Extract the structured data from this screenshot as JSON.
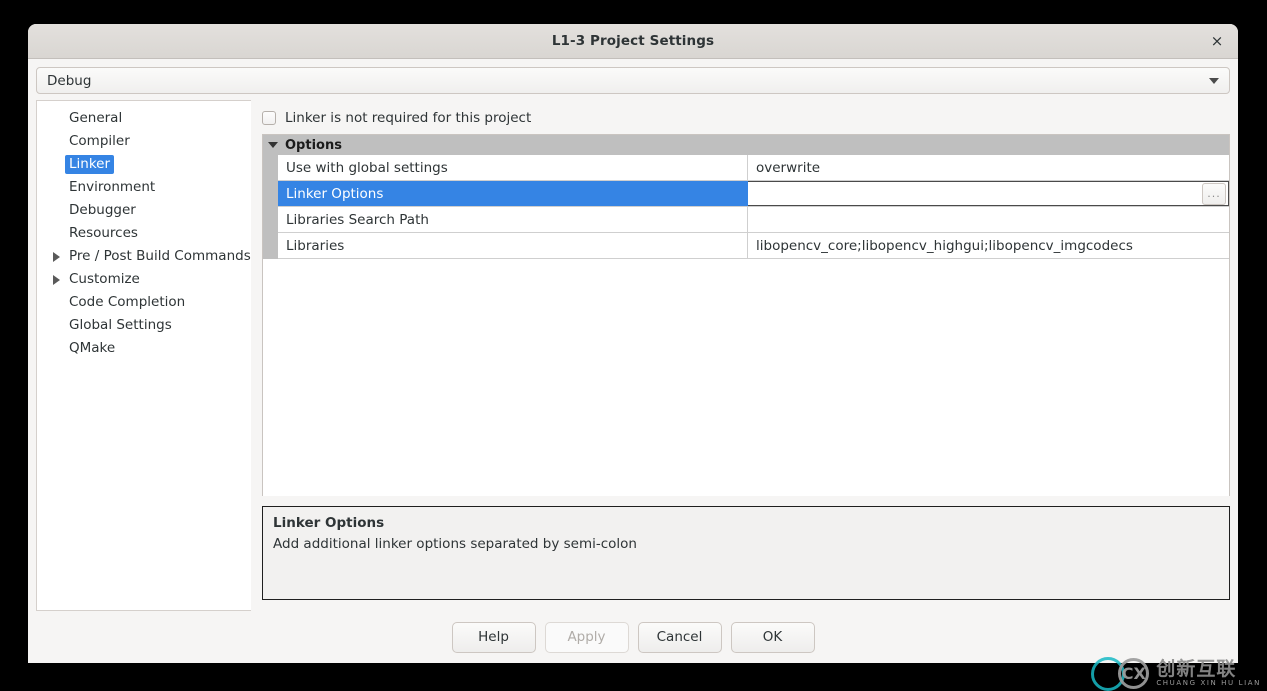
{
  "window": {
    "title": "L1-3 Project Settings",
    "close_icon": "close-icon",
    "close_glyph": "×"
  },
  "config_selector": {
    "value": "Debug",
    "arrow_icon": "chevron-down-icon"
  },
  "sidebar": {
    "items": [
      {
        "label": "General",
        "expandable": false,
        "selected": false
      },
      {
        "label": "Compiler",
        "expandable": false,
        "selected": false
      },
      {
        "label": "Linker",
        "expandable": false,
        "selected": true
      },
      {
        "label": "Environment",
        "expandable": false,
        "selected": false
      },
      {
        "label": "Debugger",
        "expandable": false,
        "selected": false
      },
      {
        "label": "Resources",
        "expandable": false,
        "selected": false
      },
      {
        "label": "Pre / Post Build Commands",
        "expandable": true,
        "selected": false
      },
      {
        "label": "Customize",
        "expandable": true,
        "selected": false
      },
      {
        "label": "Code Completion",
        "expandable": false,
        "selected": false
      },
      {
        "label": "Global Settings",
        "expandable": false,
        "selected": false
      },
      {
        "label": "QMake",
        "expandable": false,
        "selected": false
      }
    ]
  },
  "content": {
    "checkbox": {
      "label": "Linker is not required for this project",
      "checked": false
    },
    "group": {
      "label": "Options",
      "expanded": true
    },
    "rows": [
      {
        "key": "Use with global settings",
        "value": "overwrite",
        "selected": false,
        "has_ellipsis_button": false
      },
      {
        "key": "Linker Options",
        "value": "",
        "selected": true,
        "has_ellipsis_button": true,
        "ellipsis_label": "..."
      },
      {
        "key": "Libraries Search Path",
        "value": "",
        "selected": false,
        "has_ellipsis_button": false
      },
      {
        "key": "Libraries",
        "value": "libopencv_core;libopencv_highgui;libopencv_imgcodecs",
        "selected": false,
        "has_ellipsis_button": false
      }
    ],
    "description": {
      "title": "Linker Options",
      "text": "Add additional linker options separated by semi-colon"
    }
  },
  "buttons": [
    {
      "label": "Help",
      "disabled": false
    },
    {
      "label": "Apply",
      "disabled": true
    },
    {
      "label": "Cancel",
      "disabled": false
    },
    {
      "label": "OK",
      "disabled": false
    }
  ],
  "watermark": {
    "logo_text": "CX",
    "chinese": "创新互联",
    "pinyin": "CHUANG XIN HU LIAN"
  },
  "colors": {
    "accent_blue": "#3584e4",
    "group_header_grey": "#bfbfbf",
    "dialog_bg": "#f6f5f4",
    "titlebar_bg": "#ddd9d5"
  }
}
